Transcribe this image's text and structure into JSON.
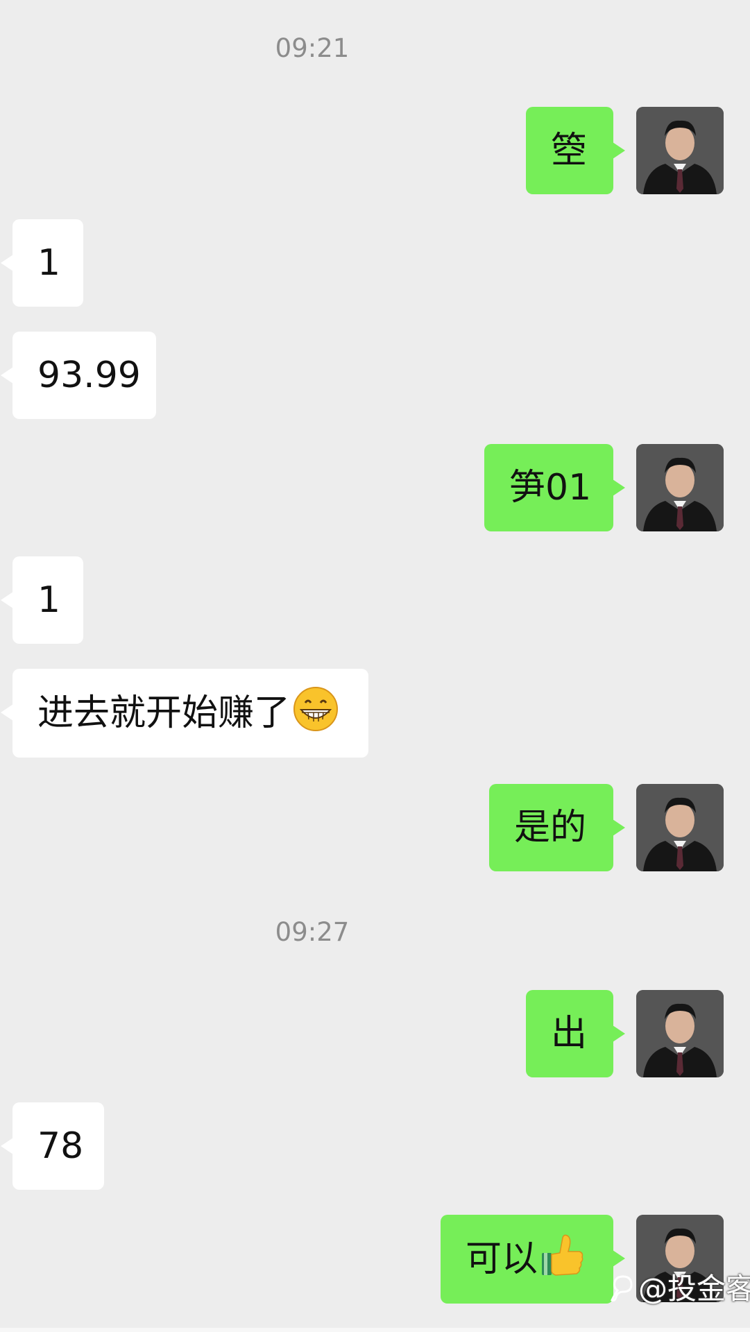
{
  "chat": {
    "timestamps": [
      "09:21",
      "09:27"
    ],
    "messages": [
      {
        "from": "me",
        "text": "箜"
      },
      {
        "from": "other",
        "text": "1"
      },
      {
        "from": "other",
        "text": "93.99"
      },
      {
        "from": "me",
        "text": "笋01"
      },
      {
        "from": "other",
        "text": "1"
      },
      {
        "from": "other",
        "text": "进去就开始赚了",
        "emoji": "grinning-face-icon"
      },
      {
        "from": "me",
        "text": "是的"
      },
      {
        "from": "me",
        "text": "出"
      },
      {
        "from": "other",
        "text": "78"
      },
      {
        "from": "me",
        "text": "可以",
        "emoji": "thumbs-up-icon"
      }
    ]
  },
  "watermark": {
    "text": "@投金客"
  },
  "colors": {
    "background": "#ededed",
    "sent_bubble": "#76ee58",
    "received_bubble": "#ffffff",
    "timestamp": "#8c8c8c"
  }
}
